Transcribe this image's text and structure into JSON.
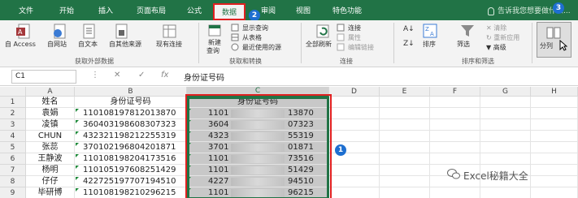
{
  "tabs": [
    {
      "label": "文件"
    },
    {
      "label": "开始"
    },
    {
      "label": "插入"
    },
    {
      "label": "页面布局"
    },
    {
      "label": "公式"
    },
    {
      "label": "数据"
    },
    {
      "label": "审阅"
    },
    {
      "label": "视图"
    },
    {
      "label": "特色功能"
    }
  ],
  "tell_me": "告诉我您想要做什么...",
  "ribbon": {
    "get_external": {
      "access": "自 Access",
      "web": "自网站",
      "text": "自文本",
      "other": "自其他来源",
      "existing": "现有连接",
      "group": "获取外部数据"
    },
    "transform": {
      "new_query": "新建",
      "new_query_sub": "查询",
      "show_queries": "显示查询",
      "from_table": "从表格",
      "recent_sources": "最近使用的源",
      "group": "获取和转换"
    },
    "connections": {
      "refresh_all": "全部刷新",
      "connections": "连接",
      "properties": "属性",
      "edit_links": "编辑链接",
      "group": "连接"
    },
    "sort_filter": {
      "sort": "排序",
      "filter": "筛选",
      "clear": "清除",
      "reapply": "重新应用",
      "advanced": "高级",
      "group": "排序和筛选"
    },
    "data_tools": {
      "text_to_columns": "分列"
    }
  },
  "formula_bar": {
    "name_box": "C1",
    "fx": "fx",
    "value": "身份证号码"
  },
  "columns": [
    "A",
    "B",
    "C",
    "D",
    "E",
    "F",
    "G",
    "H"
  ],
  "rows": [
    {
      "n": "1",
      "a": "姓名",
      "b": "身份证号码",
      "c_left": "",
      "c_right": "",
      "header": true
    },
    {
      "n": "2",
      "a": "袁娟",
      "b": "110108197812013870",
      "c_left": "1101",
      "c_right": "13870"
    },
    {
      "n": "3",
      "a": "凌镇",
      "b": "360403198608307323",
      "c_left": "3604",
      "c_right": "07323"
    },
    {
      "n": "4",
      "a": "CHUN",
      "b": "432321198212255319",
      "c_left": "4323",
      "c_right": "55319"
    },
    {
      "n": "5",
      "a": "张蕊",
      "b": "370102196804201871",
      "c_left": "3701",
      "c_right": "01871"
    },
    {
      "n": "6",
      "a": "王静波",
      "b": "110108198204173516",
      "c_left": "1101",
      "c_right": "73516"
    },
    {
      "n": "7",
      "a": "杨明",
      "b": "110105197608251429",
      "c_left": "1101",
      "c_right": "51429"
    },
    {
      "n": "8",
      "a": "仔仔",
      "b": "422725197707194510",
      "c_left": "4227",
      "c_right": "94510"
    },
    {
      "n": "9",
      "a": "毕研博",
      "b": "110108198210296215",
      "c_left": "1101",
      "c_right": "96215"
    }
  ],
  "c_header": "身份证号码",
  "badges": {
    "one": "1",
    "two": "2",
    "three": "3"
  },
  "watermark": "Excel秘籍大全",
  "colors": {
    "accent": "#217346",
    "highlight": "#e02020",
    "badge": "#1e6fd0"
  }
}
